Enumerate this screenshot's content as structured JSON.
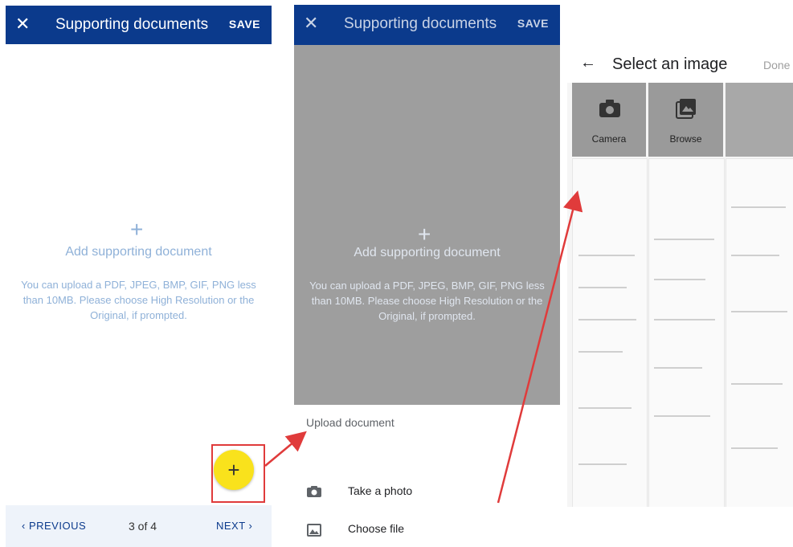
{
  "screen1": {
    "title": "Supporting documents",
    "close_label": "✕",
    "save_label": "SAVE",
    "plus_glyph": "+",
    "add_title": "Add supporting document",
    "hint": "You can upload a PDF, JPEG, BMP, GIF, PNG less than 10MB. Please choose High Resolution or the Original, if prompted.",
    "prev_label": "‹ PREVIOUS",
    "page_label": "3 of 4",
    "next_label": "NEXT ›",
    "fab_glyph": "+"
  },
  "screen2": {
    "title": "Supporting documents",
    "close_label": "✕",
    "save_label": "SAVE",
    "plus_glyph": "+",
    "add_title": "Add supporting document",
    "hint": "You can upload a PDF, JPEG, BMP, GIF, PNG less than 10MB. Please choose High Resolution or the Original, if prompted.",
    "sheet_title": "Upload document",
    "options": [
      {
        "label": "Take a photo",
        "icon": "camera-icon"
      },
      {
        "label": "Choose file",
        "icon": "image-file-icon"
      }
    ]
  },
  "screen3": {
    "back_glyph": "←",
    "title": "Select an image",
    "done_label": "Done",
    "camera_label": "Camera",
    "browse_label": "Browse"
  },
  "colors": {
    "brand": "#0b3a8c",
    "fab": "#f9e21c",
    "annotation": "#e03b3b"
  }
}
